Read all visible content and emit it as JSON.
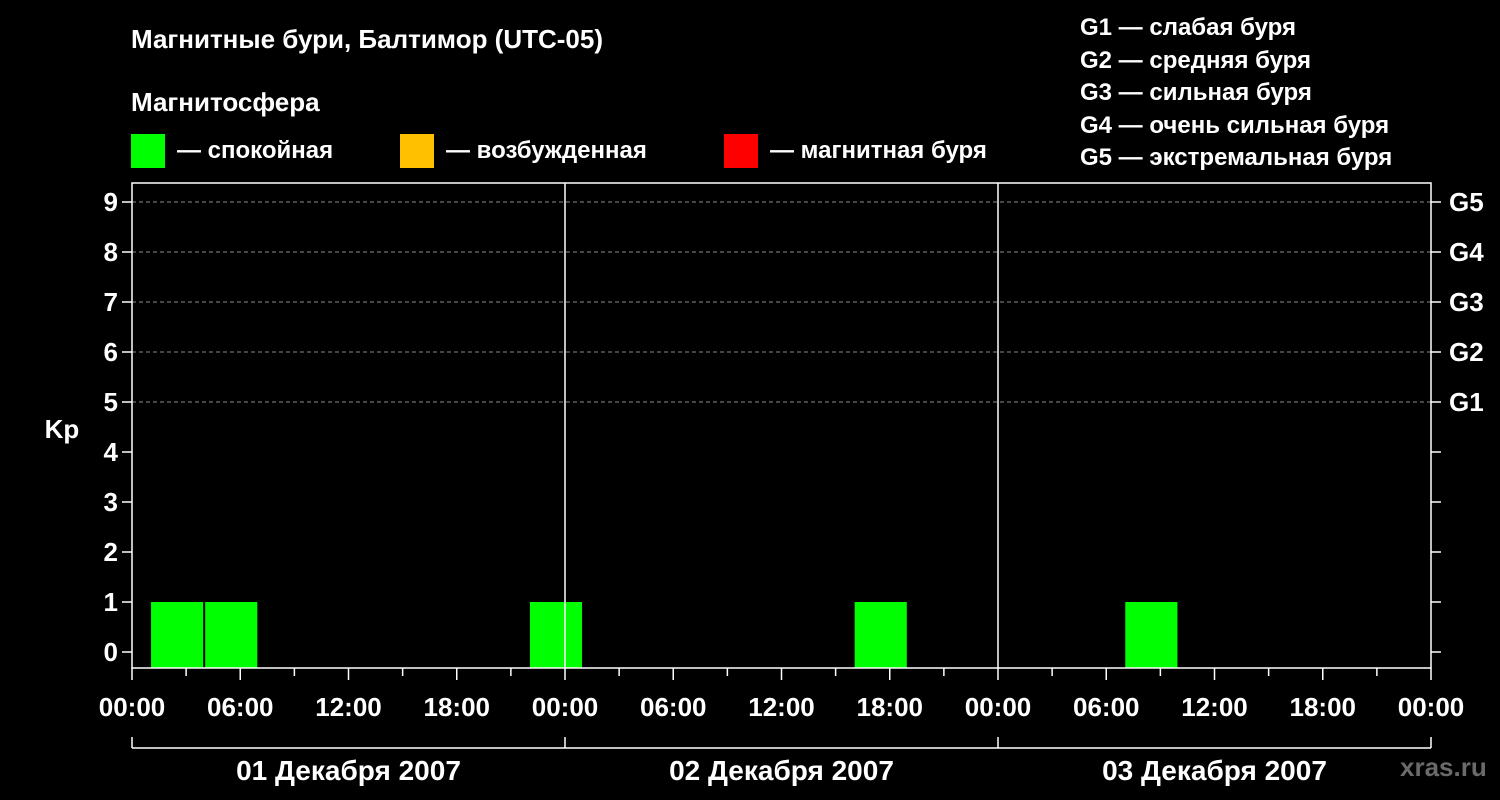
{
  "title": "Магнитные бури, Балтимор (UTC-05)",
  "subtitle": "Магнитосфера",
  "legend": [
    {
      "label": "— спокойная",
      "color": "#00ff00"
    },
    {
      "label": "— возбужденная",
      "color": "#ffc000"
    },
    {
      "label": "— магнитная буря",
      "color": "#ff0000"
    }
  ],
  "g_scale": [
    "G1 — слабая буря",
    "G2 — средняя буря",
    "G3 — сильная буря",
    "G4 — очень сильная буря",
    "G5 — экстремальная буря"
  ],
  "watermark": "xras.ru",
  "chart_data": {
    "type": "bar",
    "ylabel": "Kp",
    "ylim": [
      0,
      9
    ],
    "y_ticks": [
      "0",
      "1",
      "2",
      "3",
      "4",
      "5",
      "6",
      "7",
      "8",
      "9"
    ],
    "y2_ticks": [
      {
        "kp": 5,
        "label": "G1"
      },
      {
        "kp": 6,
        "label": "G2"
      },
      {
        "kp": 7,
        "label": "G3"
      },
      {
        "kp": 8,
        "label": "G4"
      },
      {
        "kp": 9,
        "label": "G5"
      }
    ],
    "x_range_hours": [
      0,
      72
    ],
    "x_tick_labels": [
      "00:00",
      "06:00",
      "12:00",
      "18:00",
      "00:00",
      "06:00",
      "12:00",
      "18:00",
      "00:00",
      "06:00",
      "12:00",
      "18:00",
      "00:00"
    ],
    "days": [
      "01 Декабря 2007",
      "02 Декабря 2007",
      "03 Декабря 2007"
    ],
    "bars": [
      {
        "start_hour": 1,
        "end_hour": 4,
        "kp": 1,
        "level": "спокойная",
        "color": "#00ff00"
      },
      {
        "start_hour": 4,
        "end_hour": 7,
        "kp": 1,
        "level": "спокойная",
        "color": "#00ff00"
      },
      {
        "start_hour": 22,
        "end_hour": 25,
        "kp": 1,
        "level": "спокойная",
        "color": "#00ff00"
      },
      {
        "start_hour": 40,
        "end_hour": 43,
        "kp": 1,
        "level": "спокойная",
        "color": "#00ff00"
      },
      {
        "start_hour": 55,
        "end_hour": 58,
        "kp": 1,
        "level": "спокойная",
        "color": "#00ff00"
      }
    ],
    "grid": true
  }
}
